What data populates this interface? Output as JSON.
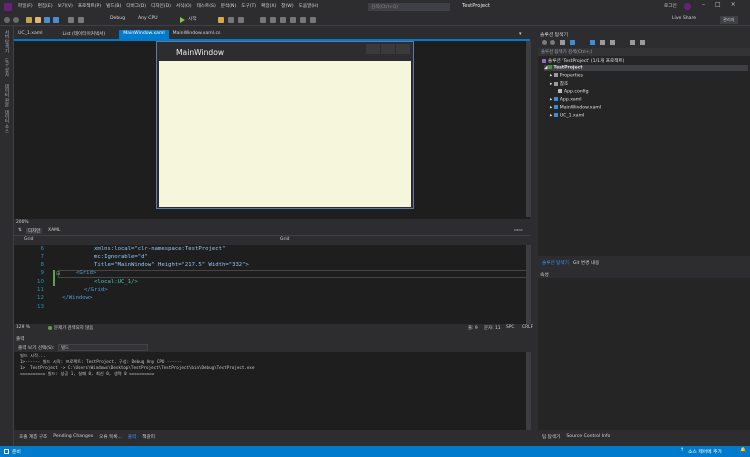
{
  "menu": [
    "파일(F)",
    "편집(E)",
    "보기(V)",
    "프로젝트(P)",
    "빌드(B)",
    "디버그(D)",
    "디자인(D)",
    "서식(O)",
    "테스트(S)",
    "분석(N)",
    "도구(T)",
    "확장(X)",
    "창(W)",
    "도움말(H)"
  ],
  "quick_launch": "검색(Ctrl+Q)",
  "project_name": "TestProject",
  "login": "로그인",
  "toolbar": {
    "config": "Debug",
    "platform": "Any CPU",
    "start": "시작",
    "live_share": "Live Share",
    "admin": "관리자"
  },
  "left_strip": [
    "서버 탐색기",
    "도구 상자",
    "데이터 원본",
    "데이터 소스"
  ],
  "doc_tabs": [
    "UC_1.xaml",
    "List (테이터이커넥서)",
    "MainWindow.xaml",
    "MainWindow.xaml.cs"
  ],
  "designer": {
    "window_title": "MainWindow",
    "zoom": "200%"
  },
  "split": {
    "design": "디자인",
    "xaml": "XAML"
  },
  "nav": {
    "left": "Grid",
    "right": "Grid"
  },
  "code_lines": [
    {
      "n": "6",
      "text": "xmlns:local=\"clr-namespace:TestProject\""
    },
    {
      "n": "7",
      "text": "mc:Ignorable=\"d\""
    },
    {
      "n": "8",
      "text": "Title=\"MainWindow\" Height=\"217.5\" Width=\"332\">"
    },
    {
      "n": "9",
      "text": "<Grid>"
    },
    {
      "n": "10",
      "text": "<local:UC_1/>"
    },
    {
      "n": "11",
      "text": "</Grid>"
    },
    {
      "n": "12",
      "text": "</Window>"
    },
    {
      "n": "13",
      "text": ""
    }
  ],
  "editor_status": {
    "zoom": "129 %",
    "issues": "문제가 검색되지 않음",
    "line": "줄: 9",
    "char": "문자: 11",
    "mode": "SPC",
    "eol": "CRLF"
  },
  "output": {
    "title": "출력",
    "source_label": "출력 보기 선택(S):",
    "source_value": "빌드",
    "lines": [
      "빌드 시작...",
      "1>------ 빌드 시작: 프로젝트: TestProject, 구성: Debug Any CPU ------",
      "1>  TestProject -> C:\\Users\\Windows\\Desktop\\TestProject\\TestProject\\bin\\Debug\\TestProject.exe",
      "========== 빌드: 성공 1, 실패 0, 최신 0, 생략 0 =========="
    ]
  },
  "bottom_tabs": [
    "호출 계층 구조",
    "Pending Changes",
    "오류 목록...",
    "출력",
    "책갈피"
  ],
  "solution_explorer": {
    "title": "솔루션 탐색기",
    "search": "솔루션 탐색기 검색(Ctrl+;)",
    "solution": "솔루션 'TestProject' (1/1개 프로젝트)",
    "project": "TestProject",
    "items": [
      "Properties",
      "참조",
      "App.config",
      "App.xaml",
      "MainWindow.xaml",
      "UC_1.xaml"
    ]
  },
  "right_tabs": [
    "솔루션 탐색기",
    "Git 변경 내용"
  ],
  "properties": {
    "title": "속성"
  },
  "right_bottom": [
    "팀 탐색기",
    "Source Control Info"
  ],
  "status": {
    "ready": "준비",
    "source_control": "소스 제어에 추가"
  },
  "colors": {
    "accent": "#007acc",
    "wpf_client": "#f6f6dd",
    "editor_bg": "#1e1e1e"
  }
}
